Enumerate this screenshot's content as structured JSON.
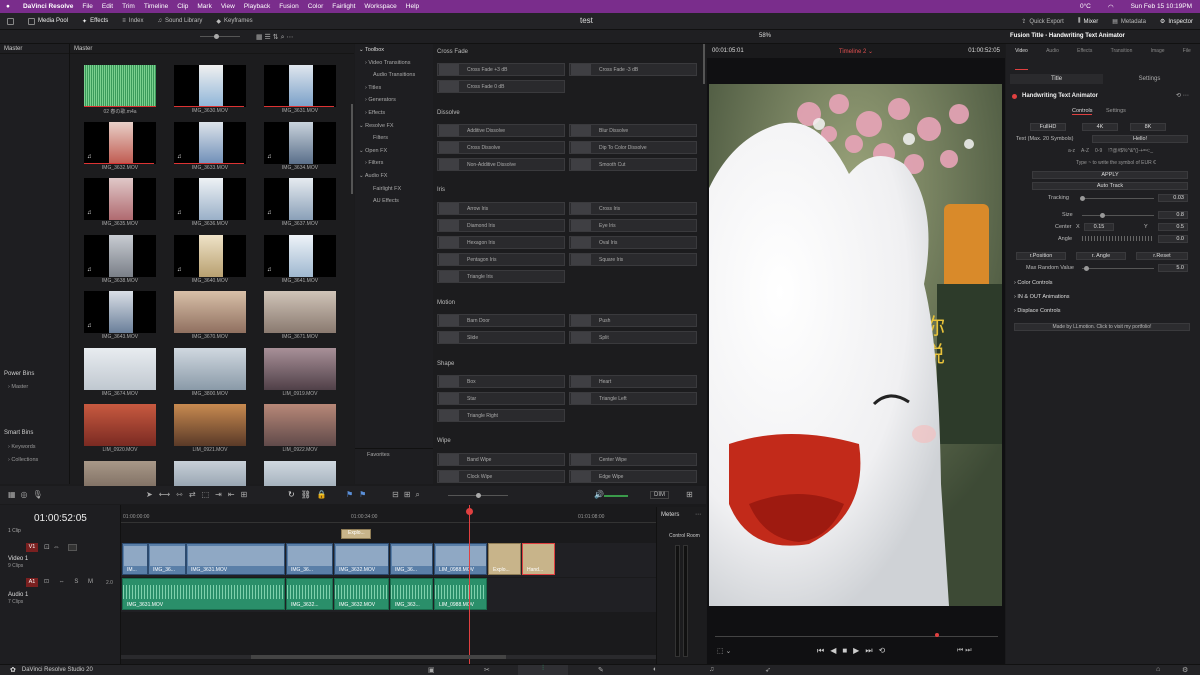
{
  "menubar": {
    "app": "DaVinci Resolve",
    "items": [
      "File",
      "Edit",
      "Trim",
      "Timeline",
      "Clip",
      "Mark",
      "View",
      "Playback",
      "Fusion",
      "Color",
      "Fairlight",
      "Workspace",
      "Help"
    ],
    "temp": "0°C",
    "datetime": "Sun Feb 15  10:19PM"
  },
  "toolbar": {
    "media_pool": "Media Pool",
    "effects": "Effects",
    "index": "Index",
    "sound_library": "Sound Library",
    "keyframes": "Keyframes",
    "project_title": "test",
    "quick_export": "Quick Export",
    "mixer": "Mixer",
    "metadata": "Metadata",
    "inspector": "Inspector"
  },
  "bins": {
    "master_header": "Master",
    "power_bins": "Power Bins",
    "power_master": "Master",
    "smart_bins": "Smart Bins",
    "keywords": "Keywords",
    "collections": "Collections"
  },
  "pool": {
    "header": "Master",
    "zoom": "58%",
    "clips": [
      "02 春の歌.m4a",
      "IMG_3630.MOV",
      "IMG_3631.MOV",
      "IMG_3632.MOV",
      "IMG_3633.MOV",
      "IMG_3634.MOV",
      "IMG_3635.MOV",
      "IMG_3636.MOV",
      "IMG_3637.MOV",
      "IMG_3638.MOV",
      "IMG_3640.MOV",
      "IMG_3641.MOV",
      "IMG_3643.MOV",
      "IMG_3670.MOV",
      "IMG_3671.MOV",
      "IMG_3674.MOV",
      "IMG_3800.MOV",
      "LIM_0919.MOV",
      "LIM_0920.MOV",
      "LIM_0921.MOV",
      "LIM_0922.MOV",
      "",
      "",
      ""
    ]
  },
  "fxtree": {
    "items": [
      "Toolbox",
      "Video Transitions",
      "Audio Transitions",
      "Titles",
      "Generators",
      "Effects",
      "Resolve FX",
      "Filters",
      "Open FX",
      "Filters",
      "Audio FX",
      "Fairlight FX",
      "AU Effects"
    ],
    "favorites": "Favorites"
  },
  "fxlist": {
    "sections": [
      {
        "title": "Cross Fade",
        "items": [
          "Cross Fade +3 dB",
          "Cross Fade -3 dB",
          "Cross Fade 0 dB"
        ]
      },
      {
        "title": "Dissolve",
        "items": [
          "Additive Dissolve",
          "Blur Dissolve",
          "Cross Dissolve",
          "Dip To Color Dissolve",
          "Non-Additive Dissolve",
          "Smooth Cut"
        ]
      },
      {
        "title": "Iris",
        "items": [
          "Arrow Iris",
          "Cross Iris",
          "Diamond Iris",
          "Eye Iris",
          "Hexagon Iris",
          "Oval Iris",
          "Pentagon Iris",
          "Square Iris",
          "Triangle Iris"
        ]
      },
      {
        "title": "Motion",
        "items": [
          "Barn Door",
          "Push",
          "Slide",
          "Split"
        ]
      },
      {
        "title": "Shape",
        "items": [
          "Box",
          "Heart",
          "Star",
          "Triangle Left",
          "Triangle Right"
        ]
      },
      {
        "title": "Wipe",
        "items": [
          "Band Wipe",
          "Center Wipe",
          "Clock Wipe",
          "Edge Wipe"
        ]
      }
    ]
  },
  "viewer": {
    "timecode_left": "00:01:05:01",
    "timeline_name": "Timeline 2",
    "timecode_right": "01:00:52:05"
  },
  "inspector": {
    "title": "Fusion Title - Handwriting Text Animator",
    "tabs": [
      "Video",
      "Audio",
      "Effects",
      "Transition",
      "Image",
      "File"
    ],
    "subtabs": [
      "Title",
      "Settings"
    ],
    "effect_name": "Handwriting Text Animator",
    "ctrl_tabs": [
      "Controls",
      "Settings"
    ],
    "res_buttons": [
      "FullHD",
      "4K",
      "8K"
    ],
    "text_label": "Text (Max. 20 Symbols)",
    "text_value": "Hello!",
    "charsets": [
      "a-z",
      "A-Z",
      "0-9",
      "!?@#$%^&*()-+=<:_"
    ],
    "hint": "Type ~ to write the symbol of EUR €",
    "apply": "APPLY",
    "autotrack": "Auto Track",
    "tracking_label": "Tracking",
    "tracking": "0.03",
    "size_label": "Size",
    "size": "0.8",
    "center_label": "Center",
    "x_label": "X",
    "center_x": "0.15",
    "y_label": "Y",
    "center_y": "0.5",
    "angle_label": "Angle",
    "angle": "0.0",
    "rbuttons": [
      "r.Position",
      "r. Angle",
      "r.Reset"
    ],
    "maxrand_label": "Max Random Value",
    "maxrand": "5.0",
    "collapsibles": [
      "Color Controls",
      "IN & OUT Animations",
      "Displace Controls"
    ],
    "credit": "Made by LLmotion. Click to visit my portfolio!"
  },
  "timeline": {
    "timecode": "01:00:52:05",
    "clip_count": "1 Clip",
    "ruler": [
      "01:00:00:00",
      "01:00:34:00",
      "01:01:08:00"
    ],
    "v1": "V1",
    "video1": "Video 1",
    "video1_clips": "9 Clips",
    "a1": "A1",
    "audio1": "Audio 1",
    "audio1_clips": "7 Clips",
    "audio_level": "2.0",
    "dim": "DIM",
    "meters": "Meters",
    "control_room": "Control Room",
    "vclips": [
      "IM...",
      "IMG_36...",
      "IMG_3631.MOV",
      "IMG_36...",
      "IMG_3632.MOV",
      "IMG_36...",
      "LIM_0988.MOV",
      "Explo...",
      "Hand..."
    ],
    "aclips": [
      "IMG_3631.MOV",
      "IMG_3632...",
      "IMG_3632.MOV",
      "IMG_363...",
      "LIM_0988.MOV"
    ],
    "title_clip": "Explo..."
  },
  "footer": {
    "version": "DaVinci Resolve Studio 20"
  }
}
